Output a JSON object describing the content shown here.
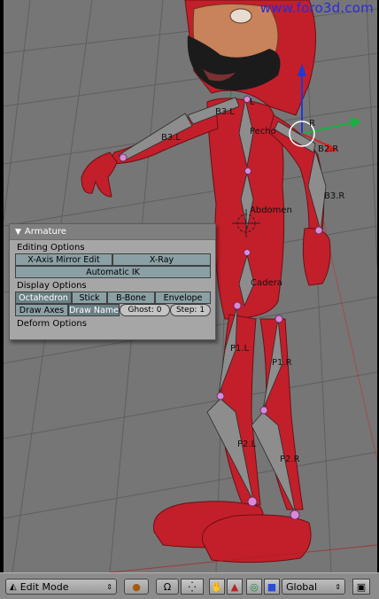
{
  "watermark": "www.foro3d.com",
  "bone_labels": {
    "b3l": "B3.L",
    "b3l_upper": "B3.L",
    "l": "L",
    "pecho": "Pecho",
    "r": "R",
    "b2r": "B2.R",
    "b3r": "B3.R",
    "abdomen": "Abdomen",
    "cadera": "Cadera",
    "p1l": "P1.L",
    "p1r": "P1.R",
    "p2l": "P2.L",
    "p2r": "P2.R"
  },
  "panel": {
    "title": "Armature",
    "editing_options": "Editing Options",
    "xaxis_mirror": "X-Axis Mirror Edit",
    "xray": "X-Ray",
    "auto_ik": "Automatic IK",
    "display_options": "Display Options",
    "octahedron": "Octahedron",
    "stick": "Stick",
    "bbone": "B-Bone",
    "envelope": "Envelope",
    "draw_axes": "Draw Axes",
    "draw_name": "Draw Name",
    "ghost": "Ghost: 0",
    "step": "Step: 1",
    "deform_options": "Deform Options"
  },
  "header": {
    "mode": "Edit Mode",
    "orientation": "Global"
  },
  "colors": {
    "viewport_bg": "#767676",
    "grid": "#5e5e5e",
    "body_red": "#c21f2a",
    "bone_gray": "#8d8d8d",
    "joint_pink": "#d88ad8"
  }
}
